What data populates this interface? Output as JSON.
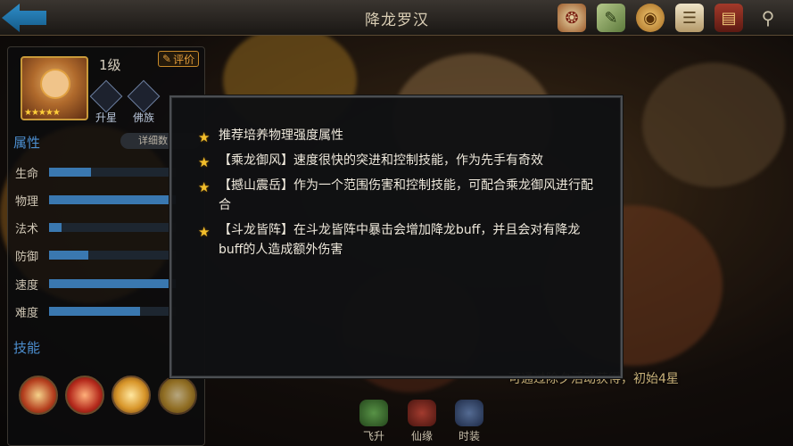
{
  "header": {
    "title": "降龙罗汉"
  },
  "top_icons": [
    {
      "name": "seal-icon",
      "glyph": "❂"
    },
    {
      "name": "scroll-icon",
      "glyph": "✎"
    },
    {
      "name": "coin-icon",
      "glyph": "◉"
    },
    {
      "name": "document-icon",
      "glyph": "☰"
    },
    {
      "name": "book-icon",
      "glyph": "▤"
    },
    {
      "name": "search-icon",
      "glyph": "⚲"
    }
  ],
  "hero": {
    "level": "1级",
    "rate_label": "评价",
    "stars": "★★★★★"
  },
  "badges": [
    {
      "label": "升星"
    },
    {
      "label": "佛族"
    }
  ],
  "attributes": {
    "heading": "属性",
    "detail_label": "详细数",
    "stats": [
      {
        "label": "生命",
        "value": 0.33
      },
      {
        "label": "物理",
        "value": 1.0
      },
      {
        "label": "法术",
        "value": 0.1
      },
      {
        "label": "防御",
        "value": 0.31
      },
      {
        "label": "速度",
        "value": 1.0
      },
      {
        "label": "难度",
        "value": 0.72
      }
    ]
  },
  "skills": {
    "heading": "技能"
  },
  "bottom_tabs": [
    {
      "label": "飞升"
    },
    {
      "label": "仙缘"
    },
    {
      "label": "时装"
    }
  ],
  "source_note": "可通过除夕活动获得，初始4星",
  "dialog": {
    "tips": [
      "推荐培养物理强度属性",
      "【乘龙御风】速度很快的突进和控制技能，作为先手有奇效",
      "【撼山震岳】作为一个范围伤害和控制技能，可配合乘龙御风进行配合",
      "【斗龙皆阵】在斗龙皆阵中暴击会增加降龙buff，并且会对有降龙buff的人造成额外伤害"
    ]
  },
  "colors": {
    "accent_blue": "#4d8fd0",
    "star_gold": "#f2be2c",
    "stat_bar": "#3a78b0"
  }
}
